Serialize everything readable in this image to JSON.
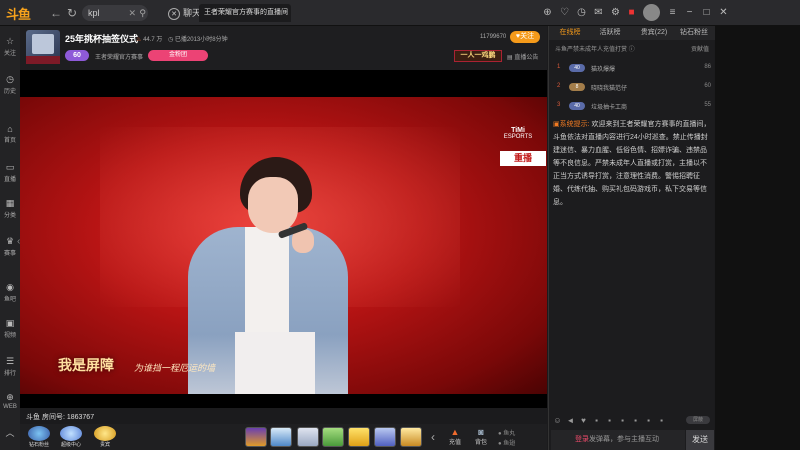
{
  "app": {
    "logo": "斗鱼"
  },
  "topbar": {
    "search_value": "kpl",
    "chat_tab": "聊天",
    "room_tab": "王者荣耀官方赛事的直播间",
    "icons": [
      "download-icon",
      "heart-icon",
      "history-icon",
      "message-icon",
      "settings-icon",
      "gift-icon",
      "avatar"
    ],
    "window": [
      "menu-icon",
      "minimize-icon",
      "maximize-icon",
      "close-icon"
    ]
  },
  "leftbar": {
    "items": [
      {
        "label": "关注"
      },
      {
        "label": "历史"
      },
      {
        "label": "首页"
      },
      {
        "label": "直播"
      },
      {
        "label": "分类"
      },
      {
        "label": "赛事"
      },
      {
        "label": "鱼吧"
      },
      {
        "label": "视频"
      },
      {
        "label": "排行"
      },
      {
        "label": "WEB"
      }
    ]
  },
  "header": {
    "title": "25年挑杯抽签仪式",
    "heat": "44.7 万",
    "followed": "已播2013小时8分钟",
    "level": "60",
    "host_name": "王者荣耀官方赛事",
    "fan_btn": "金粉团",
    "room_id_short": "11799670",
    "follow_btn": "关注",
    "announce": "直播公告",
    "gift_banner": "一人一鸡鹏"
  },
  "video": {
    "subtitle": "我是屏障",
    "subtitle2": "为谁挡一程厄运的墙",
    "timi_top": "TiMi",
    "timi_bottom": "ESPORTS",
    "replay": "重播",
    "room_no": "斗鱼 房间号: 1863767"
  },
  "bottombar": {
    "badges": [
      {
        "label": "钻石粉丝"
      },
      {
        "label": "超级中心"
      },
      {
        "label": "贵宾"
      }
    ],
    "actions": [
      {
        "label": "充值"
      },
      {
        "label": "背包"
      }
    ],
    "fish": [
      "鱼丸",
      "鱼翅"
    ]
  },
  "rightpanel": {
    "tabs": [
      "在线榜",
      "活跃榜",
      "贵宾(22)",
      "钻石粉丝"
    ],
    "sub_left": "斗鱼严禁未成年人充值打赏",
    "sub_right": "贡献值",
    "ranks": [
      {
        "num": "1",
        "badge": "40",
        "name": "猫玖爆爆",
        "val": "86"
      },
      {
        "num": "2",
        "badge": "8",
        "name": "晓晓我猫范仔",
        "val": "60"
      },
      {
        "num": "3",
        "badge": "40",
        "name": "垃圾抽卡工商",
        "val": "55"
      }
    ],
    "sys_label": "系统提示:",
    "sys_text": "欢迎来到王者荣耀官方赛事的直播间，斗鱼依法对直播内容进行24小时巡查。禁止传播封建迷信、暴力血腥、低俗色情、招嫖诈骗、违禁品等不良信息。严禁未成年人直播或打赏，主播以不正当方式诱导打赏，注意理性消费。警惕招聘征婚、代练代抽、购买礼包码游戏币，私下交易等信息。",
    "shield_toggle": "屏蔽",
    "chat_placeholder_login": "登录",
    "chat_placeholder_rest": "发弹幕，参与主播互动",
    "send": "发送"
  }
}
